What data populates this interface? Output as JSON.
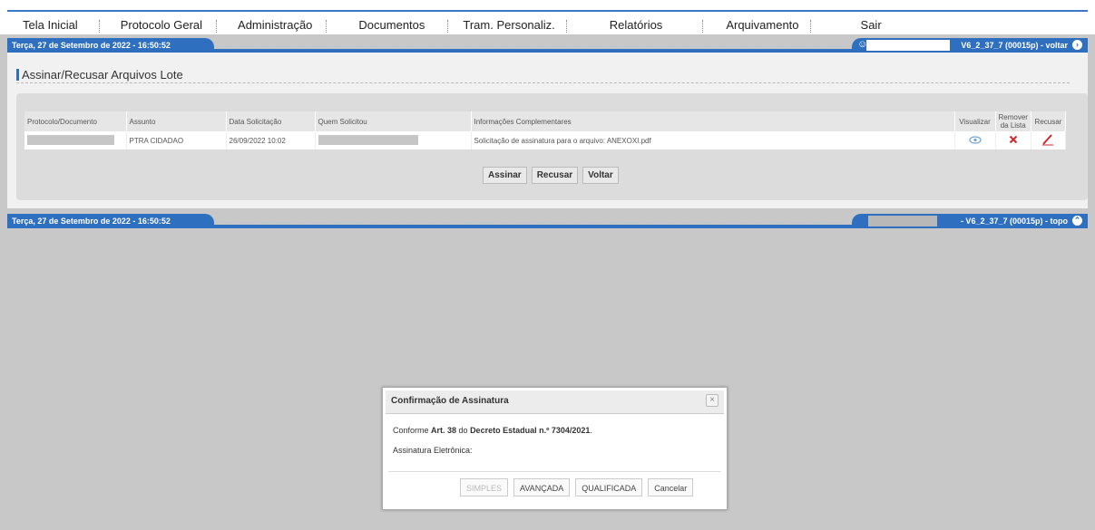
{
  "menu": [
    "Tela Inicial",
    "Protocolo Geral",
    "Administração",
    "Documentos",
    "Tram. Personaliz.",
    "Relatórios",
    "Arquivamento",
    "Sair"
  ],
  "top_bar": {
    "date": "Terça, 27 de Setembro de 2022 - 16:50:52",
    "version": "V6_2_37_7 (00015p) - voltar"
  },
  "bottom_bar": {
    "date": "Terça, 27 de Setembro de 2022 - 16:50:52",
    "version": "- V6_2_37_7 (00015p) - topo"
  },
  "page_title": "Assinar/Recusar Arquivos Lote",
  "table": {
    "headers": [
      "Protocolo/Documento",
      "Assunto",
      "Data Solicitação",
      "Quem Solicitou",
      "Informações Complementares",
      "Visualizar",
      "Remover da Lista",
      "Recusar"
    ],
    "row": {
      "assunto": "PTRA CIDADAO",
      "data": "26/09/2022 10:02",
      "info": "Solicitação de assinatura para o arquivo: ANEXOXI.pdf"
    }
  },
  "buttons": {
    "assinar": "Assinar",
    "recusar": "Recusar",
    "voltar": "Voltar"
  },
  "modal": {
    "title": "Confirmação de Assinatura",
    "line1_prefix": "Conforme ",
    "line1_art": "Art. 38",
    "line1_mid": " do ",
    "line1_decreto": "Decreto Estadual n.º 7304/2021",
    "line1_suffix": ".",
    "line2": "Assinatura Eletrônica:",
    "btn_simples": "SIMPLES",
    "btn_avancada": "AVANÇADA",
    "btn_qualificada": "QUALIFICADA",
    "btn_cancelar": "Cancelar"
  },
  "colors": {
    "accent": "#2e6fc0",
    "delete": "#d9232d"
  }
}
